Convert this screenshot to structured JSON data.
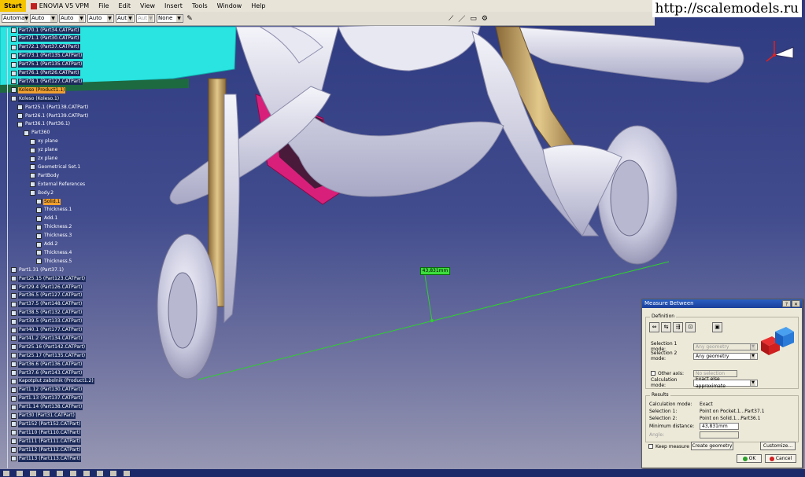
{
  "menu": {
    "items": [
      "Start",
      "ENOVIA V5 VPM",
      "File",
      "Edit",
      "View",
      "Insert",
      "Tools",
      "Window",
      "Help"
    ]
  },
  "toolbar": {
    "combos": [
      {
        "value": "Automa",
        "disabled": false
      },
      {
        "value": "Auto",
        "disabled": false
      },
      {
        "value": "Auto",
        "disabled": false
      },
      {
        "value": "Auto",
        "disabled": false
      },
      {
        "value": "Aut",
        "disabled": false
      },
      {
        "value": "Aut",
        "disabled": true
      },
      {
        "value": "None",
        "disabled": false
      }
    ]
  },
  "watermark": "http://scalemodels.ru",
  "tree": {
    "nodes": [
      {
        "label": "Part70.1 (Part34.CATPart)",
        "style": "dark"
      },
      {
        "label": "Part71.1 (Part30.CATPart)",
        "style": "dark"
      },
      {
        "label": "Part72.1 (Part37.CATPart)",
        "style": "dark"
      },
      {
        "label": "Part73.1 (Part135.CATPart)",
        "style": "dark"
      },
      {
        "label": "Part75.1 (Part135.CATPart)",
        "style": "dark"
      },
      {
        "label": "Part76.1 (Part26.CATPart)",
        "style": "dark"
      },
      {
        "label": "Part78.1 (Part127.CATPart)",
        "style": "dark"
      },
      {
        "label": "Koleso (Product1.1)",
        "style": "hl"
      },
      {
        "label": "Koleso (Koleso.1)",
        "style": "dark"
      },
      {
        "label": "Part25.1 (Part138.CATPart)",
        "style": "sub"
      },
      {
        "label": "Part26.1 (Part139.CATPart)",
        "style": "sub"
      },
      {
        "label": "Part36.1 (Part36.1)",
        "style": "sub"
      },
      {
        "label": "Part360",
        "style": "sub"
      },
      {
        "label": "xy plane",
        "style": "sub"
      },
      {
        "label": "yz plane",
        "style": "sub"
      },
      {
        "label": "zx plane",
        "style": "sub"
      },
      {
        "label": "Geometrical Set.1",
        "style": "sub"
      },
      {
        "label": "PartBody",
        "style": "sub"
      },
      {
        "label": "External References",
        "style": "sub"
      },
      {
        "label": "Body.2",
        "style": "sub"
      },
      {
        "label": "Solid.1",
        "style": "hl"
      },
      {
        "label": "Thickness.1",
        "style": "sub"
      },
      {
        "label": "Add.1",
        "style": "sub"
      },
      {
        "label": "Thickness.2",
        "style": "sub"
      },
      {
        "label": "Thickness.3",
        "style": "sub"
      },
      {
        "label": "Add.2",
        "style": "sub"
      },
      {
        "label": "Thickness.4",
        "style": "sub"
      },
      {
        "label": "Thickness.5",
        "style": "sub"
      },
      {
        "label": "Part1.31 (Part37.1)",
        "style": "sub"
      },
      {
        "label": "Part25.15 (Part123.CATPart)",
        "style": "dark"
      },
      {
        "label": "Part29.4 (Part126.CATPart)",
        "style": "dark"
      },
      {
        "label": "Part36.5 (Part127.CATPart)",
        "style": "dark"
      },
      {
        "label": "Part37.5 (Part148.CATPart)",
        "style": "dark"
      },
      {
        "label": "Part38.5 (Part132.CATPart)",
        "style": "dark"
      },
      {
        "label": "Part39.5 (Part133.CATPart)",
        "style": "dark"
      },
      {
        "label": "Part40.1 (Part177.CATPart)",
        "style": "dark"
      },
      {
        "label": "Part41.2 (Part134.CATPart)",
        "style": "dark"
      },
      {
        "label": "Part25.16 (Part142.CATPart)",
        "style": "dark"
      },
      {
        "label": "Part25.17 (Part135.CATPart)",
        "style": "dark"
      },
      {
        "label": "Part36.6 (Part136.CATPart)",
        "style": "dark"
      },
      {
        "label": "Part37.6 (Part143.CATPart)",
        "style": "dark"
      },
      {
        "label": "Kapotplut zabolnik (Product1.2)",
        "style": "dark"
      },
      {
        "label": "Part1.12 (Part130.CATPart)",
        "style": "dark"
      },
      {
        "label": "Part1.13 (Part137.CATPart)",
        "style": "dark"
      },
      {
        "label": "Part1.14 (Part138.CATPart)",
        "style": "dark"
      },
      {
        "label": "Part30 (Part31.CATPart)",
        "style": "dark"
      },
      {
        "label": "Part152 (Part152.CATPart)",
        "style": "dark"
      },
      {
        "label": "Part110 (Part110.CATPart)",
        "style": "dark"
      },
      {
        "label": "Part111 (Part111.CATPart)",
        "style": "dark"
      },
      {
        "label": "Part112 (Part112.CATPart)",
        "style": "dark"
      },
      {
        "label": "Part113 (Part113.CATPart)",
        "style": "dark"
      }
    ]
  },
  "measure_label": "43,831mm",
  "dialog": {
    "title": "Measure Between",
    "definition_legend": "Definition",
    "selection1_label": "Selection 1 mode:",
    "selection1_value": "Any geometry",
    "selection2_label": "Selection 2 mode:",
    "selection2_value": "Any geometry",
    "other_axis_label": "Other axis:",
    "other_axis_value": "No selection",
    "calc_mode_label": "Calculation mode:",
    "calc_mode_value": "Exact else approximate",
    "results_legend": "Results",
    "results": [
      {
        "label": "Calculation mode:",
        "value": "Exact"
      },
      {
        "label": "Selection 1:",
        "value": "Point on Pocket.1...Part37.1"
      },
      {
        "label": "Selection 2:",
        "value": "Point on Solid.1...Part36.1"
      }
    ],
    "min_distance_label": "Minimum distance:",
    "min_distance_value": "43,831mm",
    "angle_label": "Angle:",
    "keep_measure_label": "Keep measure",
    "create_geometry_label": "Create geometry",
    "customize_label": "Customize...",
    "ok_label": "OK",
    "cancel_label": "Cancel"
  },
  "colors": {
    "viewport_top": "#2e3a80",
    "fuselage_cyan": "#29e4e0",
    "tire": "#d2d2e6",
    "strut": "#c8a868",
    "magenta": "#d8207a",
    "measure_line": "#2fd02f",
    "titlebar": "#2a5fc4"
  }
}
